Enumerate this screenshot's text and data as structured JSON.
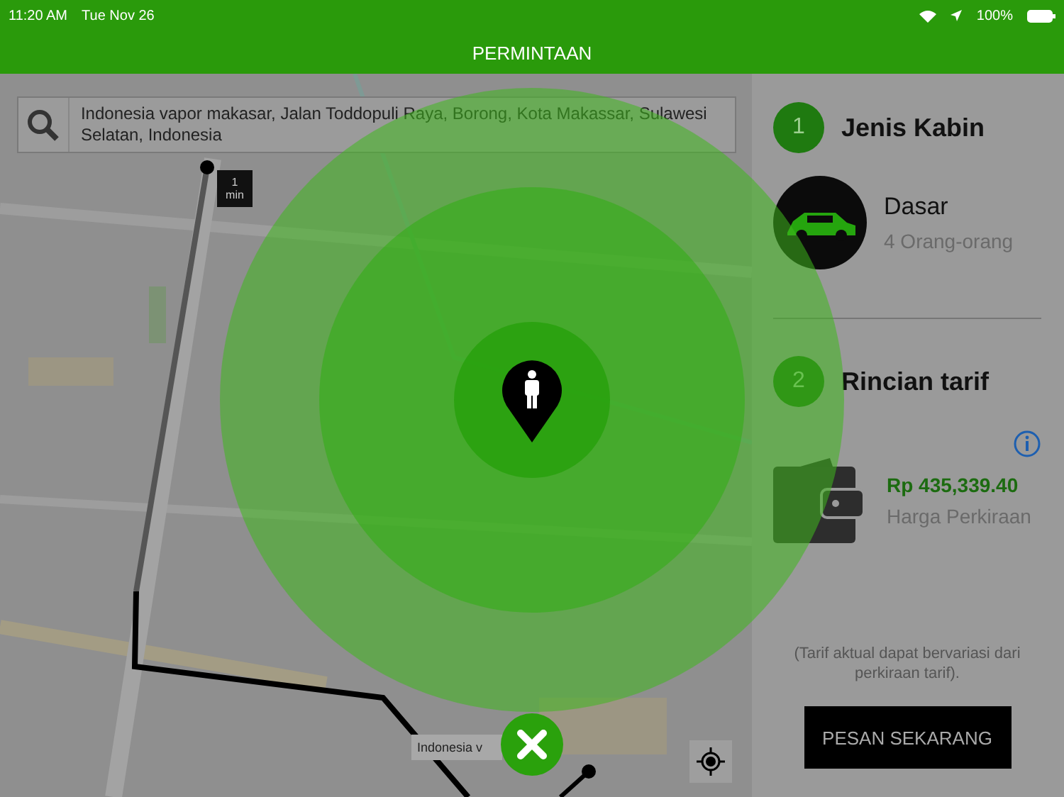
{
  "status_bar": {
    "time": "11:20 AM",
    "date": "Tue Nov 26",
    "battery": "100%"
  },
  "header": {
    "title": "PERMINTAAN"
  },
  "map": {
    "kind": "picture",
    "search": {
      "value": "Indonesia vapor makasar, Jalan Toddopuli Raya, Borong, Kota Makassar, Sulawesi Selatan, Indonesia"
    },
    "eta": {
      "value": "1",
      "unit": "min"
    },
    "marker_label": "Indonesia v"
  },
  "panel": {
    "steps": [
      {
        "number": "1",
        "title": "Jenis Kabin"
      },
      {
        "number": "2",
        "title": "Rincian tarif"
      }
    ],
    "cab": {
      "name": "Dasar",
      "capacity": "4 Orang-orang"
    },
    "fare": {
      "price": "Rp 435,339.40",
      "label": "Harga Perkiraan"
    },
    "note": "(Tarif aktual dapat bervariasi dari perkiraan tarif).",
    "button": "PESAN SEKARANG"
  }
}
